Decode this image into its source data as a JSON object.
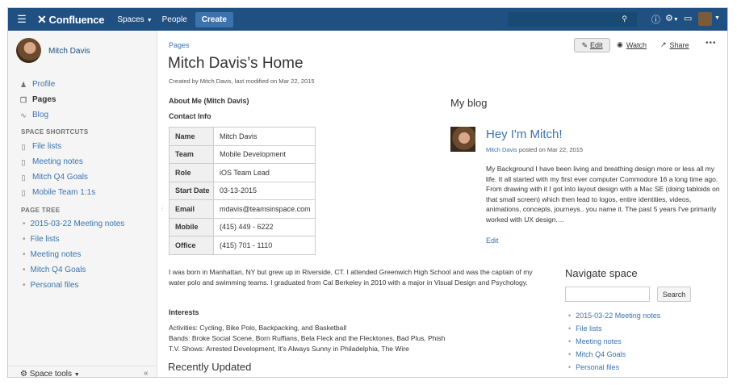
{
  "topnav": {
    "menu_icon": "hamburger-icon",
    "logo": "Confluence",
    "spaces": "Spaces",
    "people": "People",
    "create": "Create",
    "icons": [
      "search-icon",
      "help-icon",
      "gear-icon",
      "notifications-icon"
    ]
  },
  "sidebar": {
    "user_name": "Mitch Davis",
    "nav": [
      {
        "label": "Profile",
        "icon": "person-icon"
      },
      {
        "label": "Pages",
        "icon": "pages-icon"
      },
      {
        "label": "Blog",
        "icon": "rss-icon"
      }
    ],
    "shortcuts_heading": "SPACE SHORTCUTS",
    "shortcuts": [
      "File lists",
      "Meeting notes",
      "Mitch Q4 Goals",
      "Mobile Team 1:1s"
    ],
    "tree_heading": "PAGE TREE",
    "tree": [
      "2015-03-22 Meeting notes",
      "File lists",
      "Meeting notes",
      "Mitch Q4 Goals",
      "Personal files"
    ],
    "space_tools": "Space tools",
    "collapse": "«"
  },
  "page": {
    "breadcrumb": "Pages",
    "title": "Mitch Davis’s Home",
    "byline": "Created by Mitch Davis, last modified on Mar 22, 2015",
    "actions": {
      "edit": "Edit",
      "watch": "Watch",
      "share": "Share",
      "more": "•••"
    },
    "about_heading": "About Me (Mitch Davis)",
    "contact_heading": "Contact Info",
    "contact": [
      {
        "k": "Name",
        "v": "Mitch Davis"
      },
      {
        "k": "Team",
        "v": "Mobile Development"
      },
      {
        "k": "Role",
        "v": "iOS Team Lead"
      },
      {
        "k": "Start Date",
        "v": "03-13-2015"
      },
      {
        "k": "Email",
        "v": "mdavis@teamsinspace.com"
      },
      {
        "k": "Mobile",
        "v": "(415) 449 - 6222"
      },
      {
        "k": "Office",
        "v": "(415) 701 - 1110"
      }
    ],
    "bio": "I was born in Manhattan, NY but grew up in Riverside, CT. I attended Greenwich High School and was the captain of my water polo and swimming teams. I graduated from Cal Berkeley in 2010 with a major in Visual Design and Psychology.",
    "interests_heading": "Interests",
    "interests": [
      "Activities: Cycling, Bike Polo, Backpacking, and Basketball",
      "Bands: Broke Social Scene, Born Ruffians, Bela Fleck and the Flecktones, Bad Plus, Phish",
      "T.V. Shows: Arrested Development, It's Always Sunny in Philadelphia, The Wire"
    ],
    "recently_updated": "Recently Updated"
  },
  "blog": {
    "heading": "My blog",
    "post_title": "Hey I'm Mitch!",
    "post_author": "Mitch Davis",
    "post_meta": " posted on Mar 22, 2015",
    "post_body": "My Background I have been living and breathing design more or less all my life. It all started with my first ever computer Commodore 16 a long time ago. From drawing with it I got into layout design with a Mac SE (doing tabloids on that small screen) which then lead to logos, entire identities, videos, animations, concepts, journeys.. you name it. The past 5 years I've primarily worked with UX design.…",
    "edit": "Edit"
  },
  "navigate": {
    "heading": "Navigate space",
    "search_value": "",
    "search_button": "Search",
    "items": [
      "2015-03-22 Meeting notes",
      "File lists",
      "Meeting notes",
      "Mitch Q4 Goals",
      "Personal files"
    ]
  },
  "colors": {
    "nav_bg": "#205081",
    "link": "#3b73af",
    "create_bg": "#3b73af"
  }
}
